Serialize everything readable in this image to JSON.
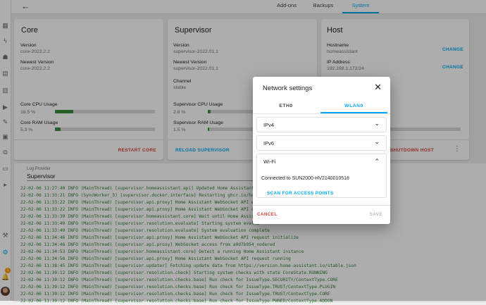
{
  "sidebar": {
    "icons": [
      {
        "name": "overview-icon",
        "glyph": "▦"
      },
      {
        "name": "energy-icon",
        "glyph": "ϟ"
      },
      {
        "name": "map-icon",
        "glyph": "☗"
      },
      {
        "name": "logbook-icon",
        "glyph": "▤"
      },
      {
        "name": "history-icon",
        "glyph": "▥"
      },
      {
        "name": "media-icon",
        "glyph": "▶"
      },
      {
        "name": "tools-icon",
        "glyph": "✎"
      },
      {
        "name": "hacs-icon",
        "glyph": "▣"
      },
      {
        "name": "network-icon",
        "glyph": "⧉"
      },
      {
        "name": "terminal-icon",
        "glyph": "▭"
      },
      {
        "name": "play-icon",
        "glyph": "▸"
      },
      {
        "name": "developer-tools-icon",
        "glyph": "⚒"
      },
      {
        "name": "settings-icon",
        "glyph": "⚙"
      }
    ],
    "notification_count": "1"
  },
  "topbar": {
    "back_glyph": "←",
    "tabs": [
      "Add-ons",
      "Backups",
      "System"
    ],
    "active_tab": "System"
  },
  "core": {
    "title": "Core",
    "version_label": "Version",
    "version_value": "core-2022.2.2",
    "newest_label": "Newest Version",
    "newest_value": "core-2022.2.2",
    "cpu_label": "Core CPU Usage",
    "cpu_value": "18.5 %",
    "cpu_fraction": 0.185,
    "ram_label": "Core RAM Usage",
    "ram_value": "5.3 %",
    "ram_fraction": 0.053,
    "action": "RESTART CORE"
  },
  "supervisor": {
    "title": "Supervisor",
    "version_label": "Version",
    "version_value": "supervisor-2022.01.1",
    "newest_label": "Newest Version",
    "newest_value": "supervisor-2022.01.1",
    "channel_label": "Channel",
    "channel_value": "stable",
    "cpu_label": "Supervisor CPU Usage",
    "cpu_value": "2.8 %",
    "cpu_fraction": 0.028,
    "ram_label": "Supervisor RAM Usage",
    "ram_value": "1.5 %",
    "ram_fraction": 0.015,
    "action": "RELOAD SUPERVISOR"
  },
  "host": {
    "title": "Host",
    "hostname_label": "Hostname",
    "hostname_value": "homeassistant",
    "hostname_action": "CHANGE",
    "ip_label": "IP Address",
    "ip_value": "192.168.1.172/24",
    "ip_action": "CHANGE",
    "action": "SHUTDOWN HOST",
    "more_glyph": "⋮"
  },
  "log": {
    "provider_label": "Log Provider",
    "provider_value": "Supervisor",
    "lines": [
      "22-02-06 11:27:40 INFO (MainThread) [supervisor.homeassistant.api] Updated Home Assistant A",
      "22-02-06 11:33:21 INFO (SyncWorker_5) [supervisor.docker.interface] Restarting ghcr.io/home",
      "22-02-06 11:33:22 INFO (MainThread) [supervisor.api.proxy] Home Assistant WebSocket API err",
      "22-02-06 11:33:22 INFO (MainThread) [supervisor.api.proxy] Home Assistant WebSocket API con",
      "22-02-06 11:33:39 INFO (MainThread) [supervisor.homeassistant.core] Wait until Home Assista",
      "22-02-06 11:33:49 INFO (MainThread) [supervisor.resolution.evaluate] Starting system evalua",
      "22-02-06 11:33:49 INFO (MainThread) [supervisor.resolution.evaluate] System evaluation complete",
      "22-02-06 11:34:46 INFO (MainThread) [supervisor.api.proxy] Home Assistant WebSocket API request initialize",
      "22-02-06 11:34:46 INFO (MainThread) [supervisor.api.proxy] WebSocket access from a0d7b954_nodered",
      "22-02-06 11:34:53 INFO (MainThread) [supervisor.homeassistant.core] Detect a running Home Assistant instance",
      "22-02-06 11:34:56 INFO (MainThread) [supervisor.api.proxy] Home Assistant WebSocket API request running",
      "22-02-06 11:38:45 INFO (MainThread) [supervisor.updater] Fetching update data from https://version.home-assistant.io/stable.json",
      "22-02-06 11:39:12 INFO (MainThread) [supervisor.resolution.check] Starting system checks with state CoreState.RUNNING",
      "22-02-06 11:39:12 INFO (MainThread) [supervisor.resolution.checks.base] Run check for IssueType.SECURITY/ContextType.CORE",
      "22-02-06 11:39:12 INFO (MainThread) [supervisor.resolution.checks.base] Run check for IssueType.TRUST/ContextType.PLUGIN",
      "22-02-06 11:39:12 INFO (MainThread) [supervisor.resolution.checks.base] Run check for IssueType.TRUST/ContextType.CORE",
      "22-02-06 11:39:12 INFO (MainThread) [supervisor.resolution.checks.base] Run check for IssueType.PWNED/ContextType.ADDON"
    ]
  },
  "dialog": {
    "title": "Network settings",
    "close_glyph": "✕",
    "tabs": [
      "ETH0",
      "WLAN0"
    ],
    "active_tab": "WLAN0",
    "sections": [
      {
        "title": "IPv4",
        "chevron": "⌄"
      },
      {
        "title": "IPv6",
        "chevron": "⌄"
      }
    ],
    "wifi": {
      "title": "Wi-Fi",
      "chevron": "⌃",
      "connected_text": "Connected to SUN2000-HV2140010518",
      "scan_label": "SCAN FOR ACCESS POINTS"
    },
    "cancel_label": "CANCEL",
    "save_label": "SAVE"
  },
  "colors": {
    "accent": "#03a9f4",
    "danger": "#db4437",
    "usage_bar": "#388e3c",
    "disabled": "#bdbdbd",
    "notification": "#ff9800"
  }
}
